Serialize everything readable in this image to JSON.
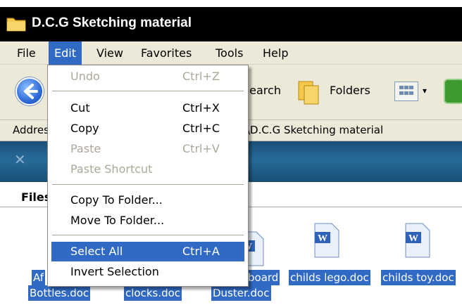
{
  "window": {
    "title": "D.C.G Sketching material"
  },
  "menubar": {
    "items": [
      {
        "label": "File"
      },
      {
        "label": "Edit"
      },
      {
        "label": "View"
      },
      {
        "label": "Favorites"
      },
      {
        "label": "Tools"
      },
      {
        "label": "Help"
      }
    ],
    "active_item": "Edit"
  },
  "toolbar": {
    "back_icon": "back-arrow-icon",
    "search_label": "Search",
    "folders_label": "Folders",
    "views_icon": "views-icon",
    "go_icon": "go-icon"
  },
  "address": {
    "label": "Address",
    "value": "\\D.C.G Sketching material"
  },
  "files_pane": {
    "header": "Files"
  },
  "edit_menu": {
    "items": [
      {
        "label": "Undo",
        "shortcut": "Ctrl+Z",
        "enabled": false
      },
      {
        "label": "Cut",
        "shortcut": "Ctrl+X",
        "enabled": true
      },
      {
        "label": "Copy",
        "shortcut": "Ctrl+C",
        "enabled": true
      },
      {
        "label": "Paste",
        "shortcut": "Ctrl+V",
        "enabled": false
      },
      {
        "label": "Paste Shortcut",
        "shortcut": "",
        "enabled": false
      },
      {
        "label": "Copy To Folder...",
        "shortcut": "",
        "enabled": true
      },
      {
        "label": "Move To Folder...",
        "shortcut": "",
        "enabled": true
      },
      {
        "label": "Select All",
        "shortcut": "Ctrl+A",
        "enabled": true,
        "highlighted": true
      },
      {
        "label": "Invert Selection",
        "shortcut": "",
        "enabled": true
      }
    ]
  },
  "files": [
    {
      "label_line1": "Af",
      "label_line2": "Bottles.doc"
    },
    {
      "label_line1": "",
      "label_line2": "clocks.doc"
    },
    {
      "label_line1": "board",
      "label_line2": "Duster.doc"
    },
    {
      "label_line1": "childs lego.doc",
      "label_line2": ""
    },
    {
      "label_line1": "childs toy.doc",
      "label_line2": ""
    }
  ],
  "colors": {
    "selection": "#316ac5",
    "menubar": "#ece9d8",
    "disabled_text": "#aca899",
    "title_bar": "#000000"
  }
}
